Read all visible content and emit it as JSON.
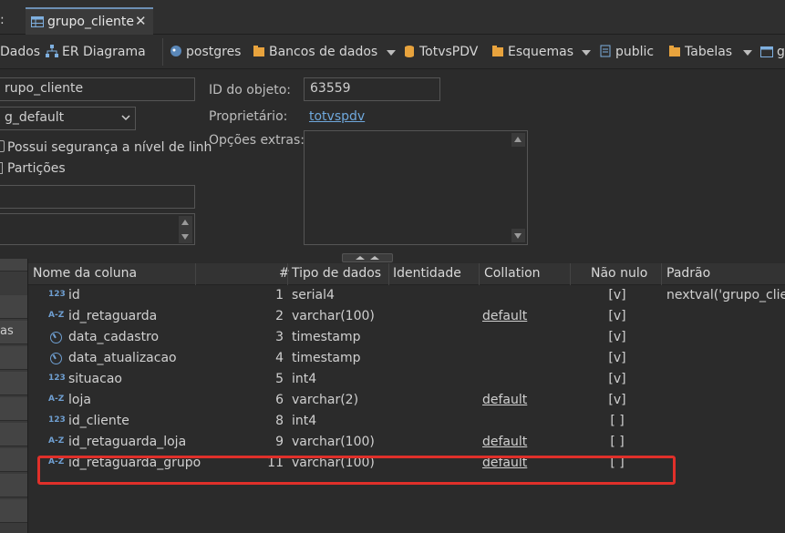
{
  "tabs": {
    "left_fragment": ":",
    "active_label": "grupo_cliente",
    "close_glyph": "✕"
  },
  "toolbar": {
    "dados": "Dados",
    "er_diagrama": "ER Diagrama",
    "postgres": "postgres",
    "bancos": "Bancos de dados",
    "totvspdv": "TotvsPDV",
    "esquemas": "Esquemas",
    "public": "public",
    "tabelas": "Tabelas",
    "grupo_fragment": "g"
  },
  "props": {
    "name_value": "rupo_cliente",
    "tablespace_value": "g_default",
    "rls_label": "Possui segurança a nível de linh",
    "particoes_label": "Partições",
    "object_id_label": "ID do objeto:",
    "object_id_value": "63559",
    "owner_label": "Proprietário:",
    "owner_value": "totvspdv",
    "extra_options_label": "Opções extras:"
  },
  "leftnav": {
    "fragment": "as"
  },
  "columns_table": {
    "headers": {
      "name": "Nome da coluna",
      "num": "#",
      "type": "Tipo de dados",
      "identity": "Identidade",
      "collation": "Collation",
      "not_null": "Não nulo",
      "default": "Padrão"
    },
    "rows": [
      {
        "icon": "123",
        "name": "id",
        "num": "1",
        "type": "serial4",
        "collation": "",
        "not_null": "[v]",
        "default": "nextval('grupo_clien"
      },
      {
        "icon": "A-Z",
        "name": "id_retaguarda",
        "num": "2",
        "type": "varchar(100)",
        "collation": "default",
        "not_null": "[v]",
        "default": ""
      },
      {
        "icon": "clock",
        "name": "data_cadastro",
        "num": "3",
        "type": "timestamp",
        "collation": "",
        "not_null": "[v]",
        "default": ""
      },
      {
        "icon": "clock",
        "name": "data_atualizacao",
        "num": "4",
        "type": "timestamp",
        "collation": "",
        "not_null": "[v]",
        "default": ""
      },
      {
        "icon": "123",
        "name": "situacao",
        "num": "5",
        "type": "int4",
        "collation": "",
        "not_null": "[v]",
        "default": ""
      },
      {
        "icon": "A-Z",
        "name": "loja",
        "num": "6",
        "type": "varchar(2)",
        "collation": "default",
        "not_null": "[v]",
        "default": ""
      },
      {
        "icon": "123",
        "name": "id_cliente",
        "num": "8",
        "type": "int4",
        "collation": "",
        "not_null": "[ ]",
        "default": ""
      },
      {
        "icon": "A-Z",
        "name": "id_retaguarda_loja",
        "num": "9",
        "type": "varchar(100)",
        "collation": "default",
        "not_null": "[ ]",
        "default": ""
      },
      {
        "icon": "A-Z",
        "name": "id_retaguarda_grupo",
        "num": "11",
        "type": "varchar(100)",
        "collation": "default",
        "not_null": "[ ]",
        "default": ""
      }
    ]
  }
}
